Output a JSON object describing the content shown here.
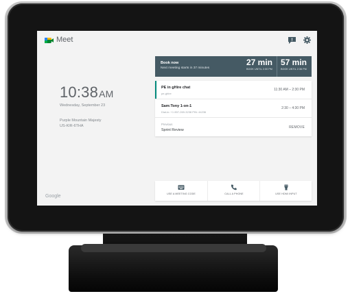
{
  "app": {
    "title": "Meet",
    "icons": {
      "logo": "meet-logo-icon",
      "feedback": "feedback-icon",
      "settings": "gear-icon"
    }
  },
  "left_panel": {
    "time": "10:38",
    "ampm": "AM",
    "date": "Wednesday, September 23",
    "room_name": "Purple Mountain Majesty",
    "room_code": "US-KIR-6THA",
    "brand": "Google"
  },
  "booking": {
    "title": "Book now",
    "subtitle": "Next meeting starts in 37 minutes",
    "options": [
      {
        "minutes": "27 min",
        "until": "BOOK UNTIL 2:00 PM"
      },
      {
        "minutes": "57 min",
        "until": "BOOK UNTIL 2:36 PM"
      }
    ]
  },
  "meetings": [
    {
      "title": "PE in gHire chat",
      "subtitle": "pe-ghire",
      "time": "11:30 AM – 2:30 PM"
    },
    {
      "title": "Sam:Tony 1-on-1",
      "subtitle": "Dial-in: +1 857-269-3238 PIN: 44236",
      "time": "2:30 – 4:30 PM"
    }
  ],
  "previous": {
    "label": "Previous",
    "title": "Sprint Review",
    "action": "REMOVE"
  },
  "actions": [
    {
      "label": "USE A MEETING CODE",
      "icon": "keyboard-icon"
    },
    {
      "label": "CALL A PHONE",
      "icon": "phone-icon"
    },
    {
      "label": "USE HDMI INPUT",
      "icon": "hdmi-icon"
    }
  ],
  "colors": {
    "accent": "#00897b",
    "booking_bg": "#455a64",
    "screen_bg": "#f3f3f3",
    "meet_green": "#00832d"
  }
}
